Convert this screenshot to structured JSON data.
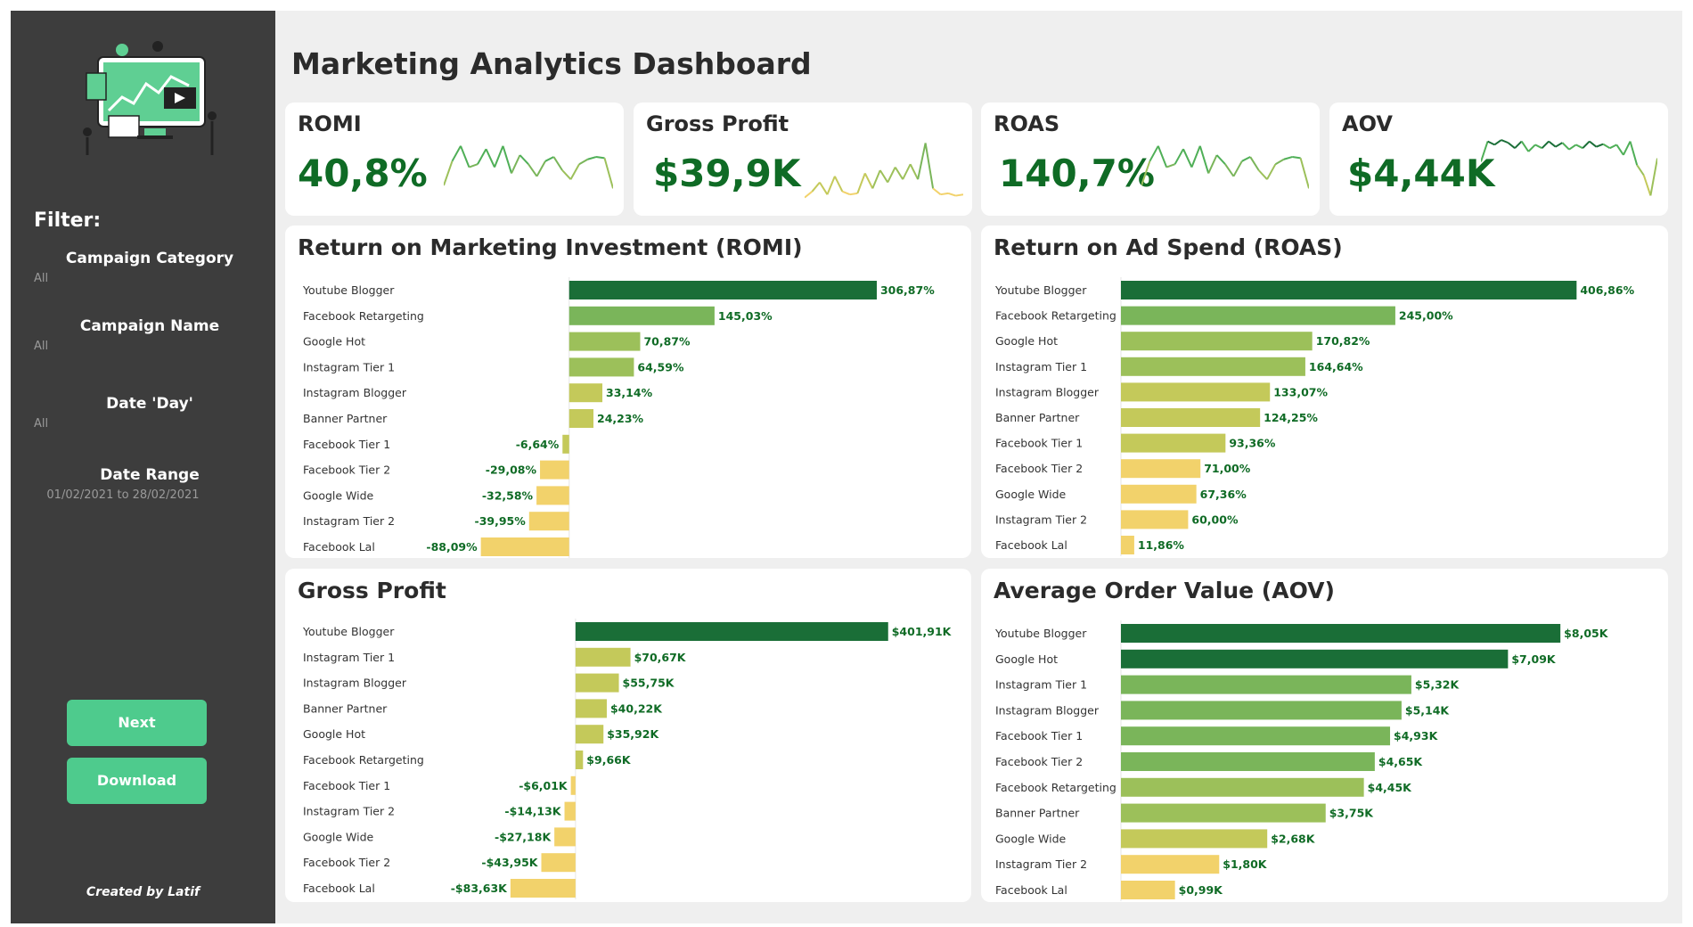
{
  "dashboard": {
    "title": "Marketing Analytics Dashboard"
  },
  "sidebar": {
    "filter_title": "Filter:",
    "filters": [
      {
        "label": "Campaign Category",
        "value": "All"
      },
      {
        "label": "Campaign Name",
        "value": "All"
      },
      {
        "label": "Date 'Day'",
        "value": "All"
      },
      {
        "label": "Date Range",
        "value": "01/02/2021 to 28/02/2021"
      }
    ],
    "buttons": {
      "next": "Next",
      "download": "Download"
    },
    "credit": "Created by Latif",
    "illustration_icon": "analytics-illustration-icon"
  },
  "kpis": [
    {
      "title": "ROMI",
      "value": "40,8%",
      "spark": [
        0.25,
        0.65,
        0.9,
        0.55,
        0.6,
        0.85,
        0.55,
        0.9,
        0.45,
        0.75,
        0.6,
        0.4,
        0.65,
        0.72,
        0.5,
        0.35,
        0.6,
        0.68,
        0.72,
        0.7,
        0.2
      ]
    },
    {
      "title": "Gross Profit",
      "value": "$39,9K",
      "spark": [
        0.05,
        0.15,
        0.3,
        0.1,
        0.4,
        0.15,
        0.1,
        0.12,
        0.45,
        0.2,
        0.5,
        0.3,
        0.55,
        0.35,
        0.6,
        0.35,
        0.95,
        0.2,
        0.1,
        0.12,
        0.08,
        0.1
      ]
    },
    {
      "title": "ROAS",
      "value": "140,7%",
      "spark": [
        0.25,
        0.65,
        0.9,
        0.55,
        0.6,
        0.85,
        0.55,
        0.9,
        0.45,
        0.75,
        0.6,
        0.4,
        0.65,
        0.72,
        0.5,
        0.35,
        0.6,
        0.68,
        0.72,
        0.7,
        0.2
      ]
    },
    {
      "title": "AOV",
      "value": "$4,44K",
      "spark": [
        0.6,
        0.9,
        0.85,
        0.92,
        0.88,
        0.8,
        0.9,
        0.75,
        0.85,
        0.8,
        0.9,
        0.82,
        0.88,
        0.78,
        0.85,
        0.8,
        0.9,
        0.82,
        0.86,
        0.8,
        0.85,
        0.7,
        0.9,
        0.55,
        0.4,
        0.1,
        0.65
      ]
    }
  ],
  "colors": {
    "scale": [
      "#f2d26b",
      "#c4c95a",
      "#9cc05a",
      "#7ab55a",
      "#4faf57",
      "#1a6e37"
    ],
    "label": "#0f6b25",
    "accent_button": "#4ecb8d",
    "sidebar_bg": "#3d3d3d"
  },
  "chart_data": [
    {
      "id": "romi",
      "type": "bar",
      "orientation": "horizontal",
      "title": "Return on Marketing Investment (ROMI)",
      "categories": [
        "Youtube Blogger",
        "Facebook Retargeting",
        "Google Hot",
        "Instagram Tier 1",
        "Instagram Blogger",
        "Banner Partner",
        "Facebook Tier 1",
        "Facebook Tier 2",
        "Google Wide",
        "Instagram Tier 2",
        "Facebook Lal"
      ],
      "values": [
        306.87,
        145.03,
        70.87,
        64.59,
        33.14,
        24.23,
        -6.64,
        -29.08,
        -32.58,
        -39.95,
        -88.09
      ],
      "labels": [
        "306,87%",
        "145,03%",
        "70,87%",
        "64,59%",
        "33,14%",
        "24,23%",
        "-6,64%",
        "-29,08%",
        "-32,58%",
        "-39,95%",
        "-88,09%"
      ],
      "xlim": [
        -150,
        330
      ]
    },
    {
      "id": "roas",
      "type": "bar",
      "orientation": "horizontal",
      "title": "Return on Ad Spend (ROAS)",
      "categories": [
        "Youtube Blogger",
        "Facebook Retargeting",
        "Google Hot",
        "Instagram Tier 1",
        "Instagram Blogger",
        "Banner Partner",
        "Facebook Tier 1",
        "Facebook Tier 2",
        "Google Wide",
        "Instagram Tier 2",
        "Facebook Lal"
      ],
      "values": [
        406.86,
        245.0,
        170.82,
        164.64,
        133.07,
        124.25,
        93.36,
        71.0,
        67.36,
        60.0,
        11.86
      ],
      "labels": [
        "406,86%",
        "245,00%",
        "170,82%",
        "164,64%",
        "133,07%",
        "124,25%",
        "93,36%",
        "71,00%",
        "67,36%",
        "60,00%",
        "11,86%"
      ],
      "xlim": [
        0,
        440
      ]
    },
    {
      "id": "gross",
      "type": "bar",
      "orientation": "horizontal",
      "title": "Gross Profit",
      "categories": [
        "Youtube Blogger",
        "Instagram Tier 1",
        "Instagram Blogger",
        "Banner Partner",
        "Google Hot",
        "Facebook Retargeting",
        "Facebook Tier 1",
        "Instagram Tier 2",
        "Google Wide",
        "Facebook Tier 2",
        "Facebook Lal"
      ],
      "values": [
        401.91,
        70.67,
        55.75,
        40.22,
        35.92,
        9.66,
        -6.01,
        -14.13,
        -27.18,
        -43.95,
        -83.63
      ],
      "labels": [
        "$401,91K",
        "$70,67K",
        "$55,75K",
        "$40,22K",
        "$35,92K",
        "$9,66K",
        "-$6,01K",
        "-$14,13K",
        "-$27,18K",
        "-$43,95K",
        "-$83,63K"
      ],
      "xlim": [
        -190,
        440
      ]
    },
    {
      "id": "aov",
      "type": "bar",
      "orientation": "horizontal",
      "title": "Average Order Value (AOV)",
      "categories": [
        "Youtube Blogger",
        "Google Hot",
        "Instagram Tier 1",
        "Instagram Blogger",
        "Facebook Tier 1",
        "Facebook Tier 2",
        "Facebook Retargeting",
        "Banner Partner",
        "Google Wide",
        "Instagram Tier 2",
        "Facebook Lal"
      ],
      "values": [
        8.05,
        7.09,
        5.32,
        5.14,
        4.93,
        4.65,
        4.45,
        3.75,
        2.68,
        1.8,
        0.99
      ],
      "labels": [
        "$8,05K",
        "$7,09K",
        "$5,32K",
        "$5,14K",
        "$4,93K",
        "$4,65K",
        "$4,45K",
        "$3,75K",
        "$2,68K",
        "$1,80K",
        "$0,99K"
      ],
      "xlim": [
        0,
        8.7
      ]
    }
  ]
}
